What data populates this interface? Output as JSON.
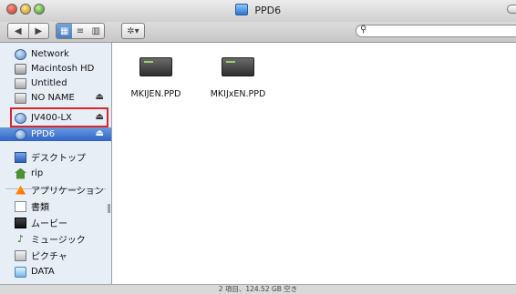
{
  "window": {
    "title": "PPD6"
  },
  "toolbar": {
    "back": "◀",
    "forward": "▶",
    "view_icon": "▦",
    "view_list": "≡",
    "view_columns": "▥",
    "action": "✲▾",
    "search": {
      "value": "",
      "placeholder": ""
    }
  },
  "sidebar": {
    "devices": [
      {
        "label": "Network",
        "icon": "network-icon"
      },
      {
        "label": "Macintosh HD",
        "icon": "hard-disk-icon"
      },
      {
        "label": "Untitled",
        "icon": "disk-icon"
      },
      {
        "label": "NO NAME",
        "icon": "disk-icon",
        "eject": "⏏"
      },
      {
        "label": "JV400-LX",
        "icon": "network-volume-icon",
        "eject": "⏏"
      },
      {
        "label": "PPD6",
        "icon": "network-volume-icon",
        "eject": "⏏"
      }
    ],
    "places": [
      {
        "label": "デスクトップ",
        "icon": "desktop-icon"
      },
      {
        "label": "rip",
        "icon": "home-icon"
      },
      {
        "label": "アプリケーション",
        "icon": "applications-icon"
      },
      {
        "label": "書類",
        "icon": "documents-icon"
      },
      {
        "label": "ムービー",
        "icon": "movies-icon"
      },
      {
        "label": "ミュージック",
        "icon": "music-icon"
      },
      {
        "label": "ピクチャ",
        "icon": "pictures-icon"
      },
      {
        "label": "DATA",
        "icon": "folder-icon"
      }
    ]
  },
  "content": {
    "files": [
      {
        "name": "MKIJEN.PPD",
        "icon": "ppd-file-icon"
      },
      {
        "name": "MKIJxEN.PPD",
        "icon": "ppd-file-icon"
      }
    ]
  },
  "status": {
    "text": "2 項目、124.52 GB 空き"
  }
}
